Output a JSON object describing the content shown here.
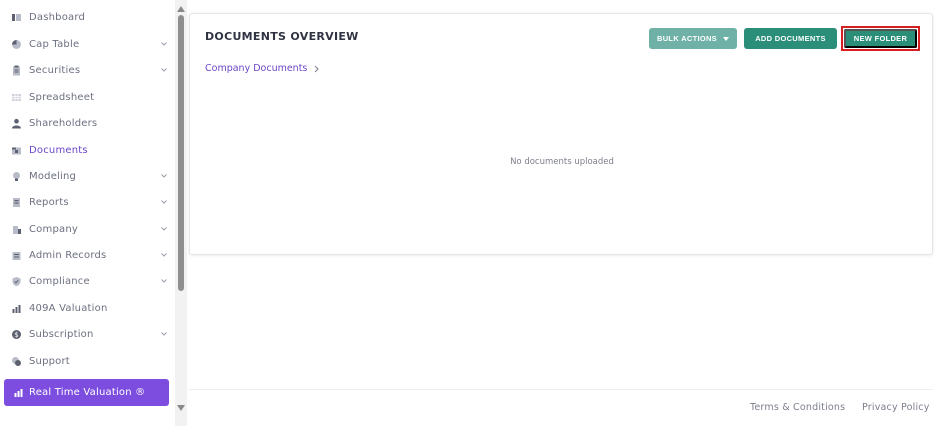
{
  "sidebar": {
    "items": [
      {
        "label": "Dashboard",
        "icon": "dashboard-icon",
        "has_chevron": false
      },
      {
        "label": "Cap Table",
        "icon": "pie-chart-icon",
        "has_chevron": true
      },
      {
        "label": "Securities",
        "icon": "clipboard-icon",
        "has_chevron": true
      },
      {
        "label": "Spreadsheet",
        "icon": "spreadsheet-icon",
        "has_chevron": false
      },
      {
        "label": "Shareholders",
        "icon": "person-icon",
        "has_chevron": false
      },
      {
        "label": "Documents",
        "icon": "folder-icon",
        "has_chevron": false,
        "active": true
      },
      {
        "label": "Modeling",
        "icon": "bulb-icon",
        "has_chevron": true
      },
      {
        "label": "Reports",
        "icon": "report-icon",
        "has_chevron": true
      },
      {
        "label": "Company",
        "icon": "building-icon",
        "has_chevron": true
      },
      {
        "label": "Admin Records",
        "icon": "admin-records-icon",
        "has_chevron": true
      },
      {
        "label": "Compliance",
        "icon": "shield-icon",
        "has_chevron": true
      },
      {
        "label": "409A Valuation",
        "icon": "bar-chart-icon",
        "has_chevron": false
      },
      {
        "label": "Subscription",
        "icon": "dollar-icon",
        "has_chevron": true
      },
      {
        "label": "Support",
        "icon": "support-icon",
        "has_chevron": false
      }
    ],
    "cta": {
      "label": "Real Time Valuation ®",
      "icon": "bar-chart-icon"
    }
  },
  "main": {
    "title": "DOCUMENTS OVERVIEW",
    "buttons": {
      "bulk_actions": "BULK ACTIONS",
      "add_documents": "ADD DOCUMENTS",
      "new_folder": "NEW FOLDER"
    },
    "breadcrumb": "Company Documents",
    "empty_message": "No documents uploaded"
  },
  "footer": {
    "terms": "Terms & Conditions",
    "privacy": "Privacy Policy"
  },
  "colors": {
    "accent_purple": "#6b47c8",
    "cta_purple": "#7c4ddf",
    "teal_primary": "#2a8e78",
    "teal_muted": "#6fb1a6",
    "highlight_red": "#d42020"
  }
}
